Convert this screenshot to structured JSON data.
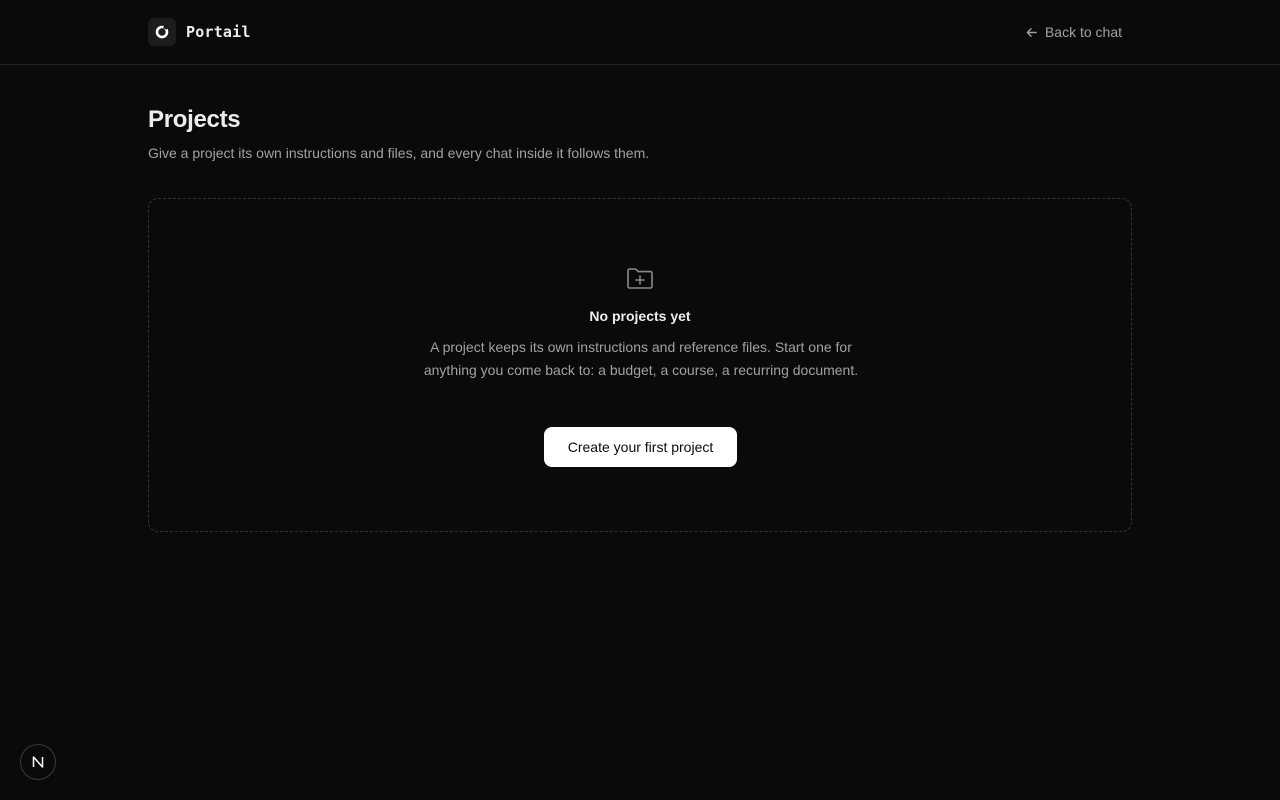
{
  "app": {
    "brand_name": "Portail",
    "logo_icon": "ring-logo-icon",
    "back_link": {
      "label": "Back to chat",
      "icon": "arrow-left-icon"
    }
  },
  "page": {
    "title": "Projects",
    "subtitle": "Give a project its own instructions and files, and every chat inside it follows them."
  },
  "empty_state": {
    "icon": "folder-plus-icon",
    "title": "No projects yet",
    "description": "A project keeps its own instructions and reference files. Start one for anything you come back to: a budget, a course, a recurring document.",
    "cta_label": "Create your first project"
  },
  "dev_badge": {
    "letter": "N",
    "icon": "nextjs-badge-icon"
  },
  "colors": {
    "background": "#0a0a0a",
    "text_primary": "#ededed",
    "text_muted": "#a1a1a1",
    "border": "#222222",
    "button_bg": "#ffffff",
    "button_text": "#0a0a0a"
  }
}
